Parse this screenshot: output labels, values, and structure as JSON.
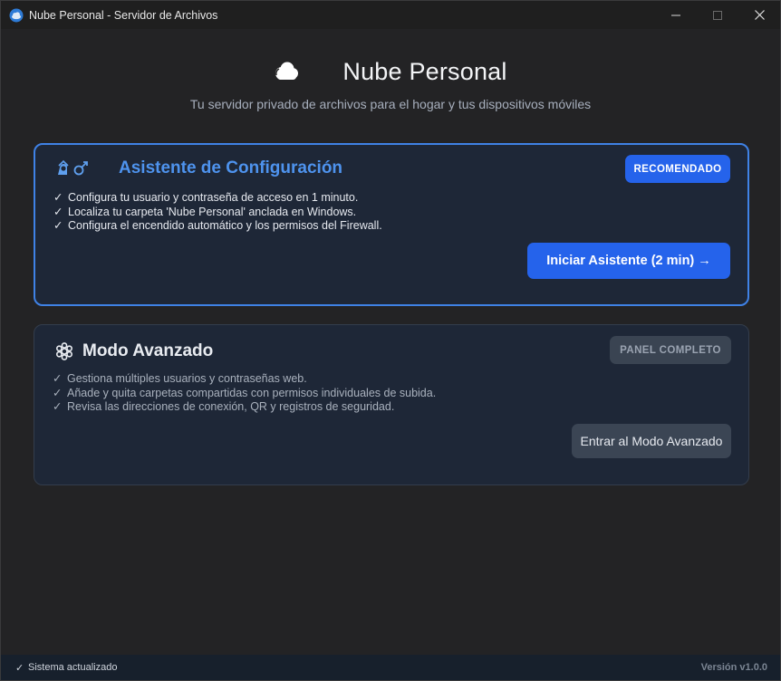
{
  "window": {
    "title": "Nube Personal - Servidor de Archivos",
    "app_icon": "cloud-app-icon",
    "controls": [
      "minimize-icon",
      "maximize-icon",
      "close-icon"
    ]
  },
  "header": {
    "icon": "cloud-icon",
    "title": "Nube Personal",
    "subtitle": "Tu servidor privado de archivos para el hogar y tus dispositivos móviles"
  },
  "wizard_card": {
    "icon": "setup-wizard-icon",
    "title": "Asistente de Configuración",
    "badge": "RECOMENDADO",
    "check": "✓",
    "features": [
      "Configura tu usuario y contraseña de acceso en 1 minuto.",
      "Localiza tu carpeta 'Nube Personal' anclada en Windows.",
      "Configura el encendido automático y los permisos del Firewall."
    ],
    "button_label": "Iniciar Asistente (2 min) →"
  },
  "advanced_card": {
    "icon": "gear-icon",
    "title": "Modo Avanzado",
    "badge": "PANEL COMPLETO",
    "check": "✓",
    "features": [
      "Gestiona múltiples usuarios y contraseñas web.",
      "Añade y quita carpetas compartidas con permisos individuales de subida.",
      "Revisa las direcciones de conexión, QR y registros de seguridad."
    ],
    "button_label": "Entrar al Modo Avanzado"
  },
  "status_bar": {
    "check": "✓",
    "status": "Sistema actualizado",
    "version": "Versión v1.0.0"
  },
  "colors": {
    "accent": "#2563eb",
    "accent_text": "#4e93ee",
    "background": "#232325",
    "card": "#1e2737"
  }
}
